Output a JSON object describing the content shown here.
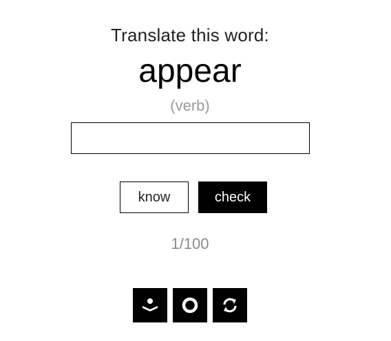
{
  "quiz": {
    "prompt": "Translate this word:",
    "word": "appear",
    "part_of_speech": "(verb)",
    "answer_value": "",
    "answer_placeholder": ""
  },
  "actions": {
    "know_label": "know",
    "check_label": "check"
  },
  "progress": {
    "text": "1/100",
    "current": 1,
    "total": 100
  },
  "toolbar": {
    "icons": [
      "reading-person-icon",
      "circle-icon",
      "refresh-icon"
    ]
  },
  "colors": {
    "background": "#ffffff",
    "primary": "#000000",
    "muted_text": "#9a9a9a"
  }
}
